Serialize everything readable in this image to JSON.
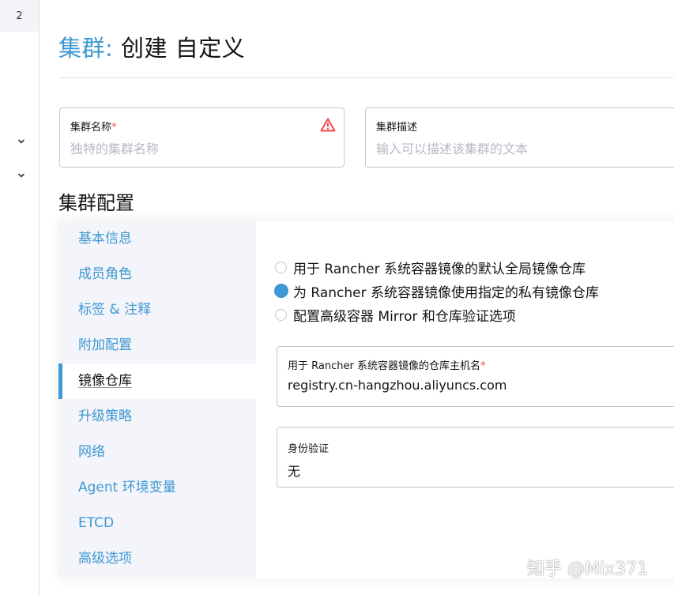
{
  "rail": {
    "badge": "2"
  },
  "header": {
    "title_prefix": "集群:",
    "title_rest": " 创建 自定义"
  },
  "cluster_name": {
    "label": "集群名称",
    "required_mark": "*",
    "placeholder": "独特的集群名称"
  },
  "cluster_description": {
    "label": "集群描述",
    "placeholder": "输入可以描述该集群的文本"
  },
  "config": {
    "title": "集群配置",
    "nav": [
      {
        "label": "基本信息"
      },
      {
        "label": "成员角色"
      },
      {
        "label": "标签 & 注释"
      },
      {
        "label": "附加配置"
      },
      {
        "label": "镜像仓库"
      },
      {
        "label": "升级策略"
      },
      {
        "label": "网络"
      },
      {
        "label": "Agent 环境变量"
      },
      {
        "label": "ETCD"
      },
      {
        "label": "高级选项"
      }
    ],
    "active_nav": "镜像仓库",
    "registry_options": [
      {
        "label": "用于 Rancher 系统容器镜像的默认全局镜像仓库",
        "checked": false
      },
      {
        "label": "为 Rancher 系统容器镜像使用指定的私有镜像仓库",
        "checked": true
      },
      {
        "label": "配置高级容器 Mirror 和仓库验证选项",
        "checked": false
      }
    ],
    "registry_host": {
      "label": "用于 Rancher 系统容器镜像的仓库主机名",
      "required_mark": "*",
      "value": "registry.cn-hangzhou.aliyuncs.com"
    },
    "auth": {
      "label": "身份验证",
      "value": "无"
    }
  },
  "watermark": "知乎 @Mix371",
  "colors": {
    "accent": "#3d98d3",
    "required": "#f64747",
    "text": "#141419",
    "placeholder": "#b6b8c3",
    "nav_bg": "#f4f5fa"
  }
}
